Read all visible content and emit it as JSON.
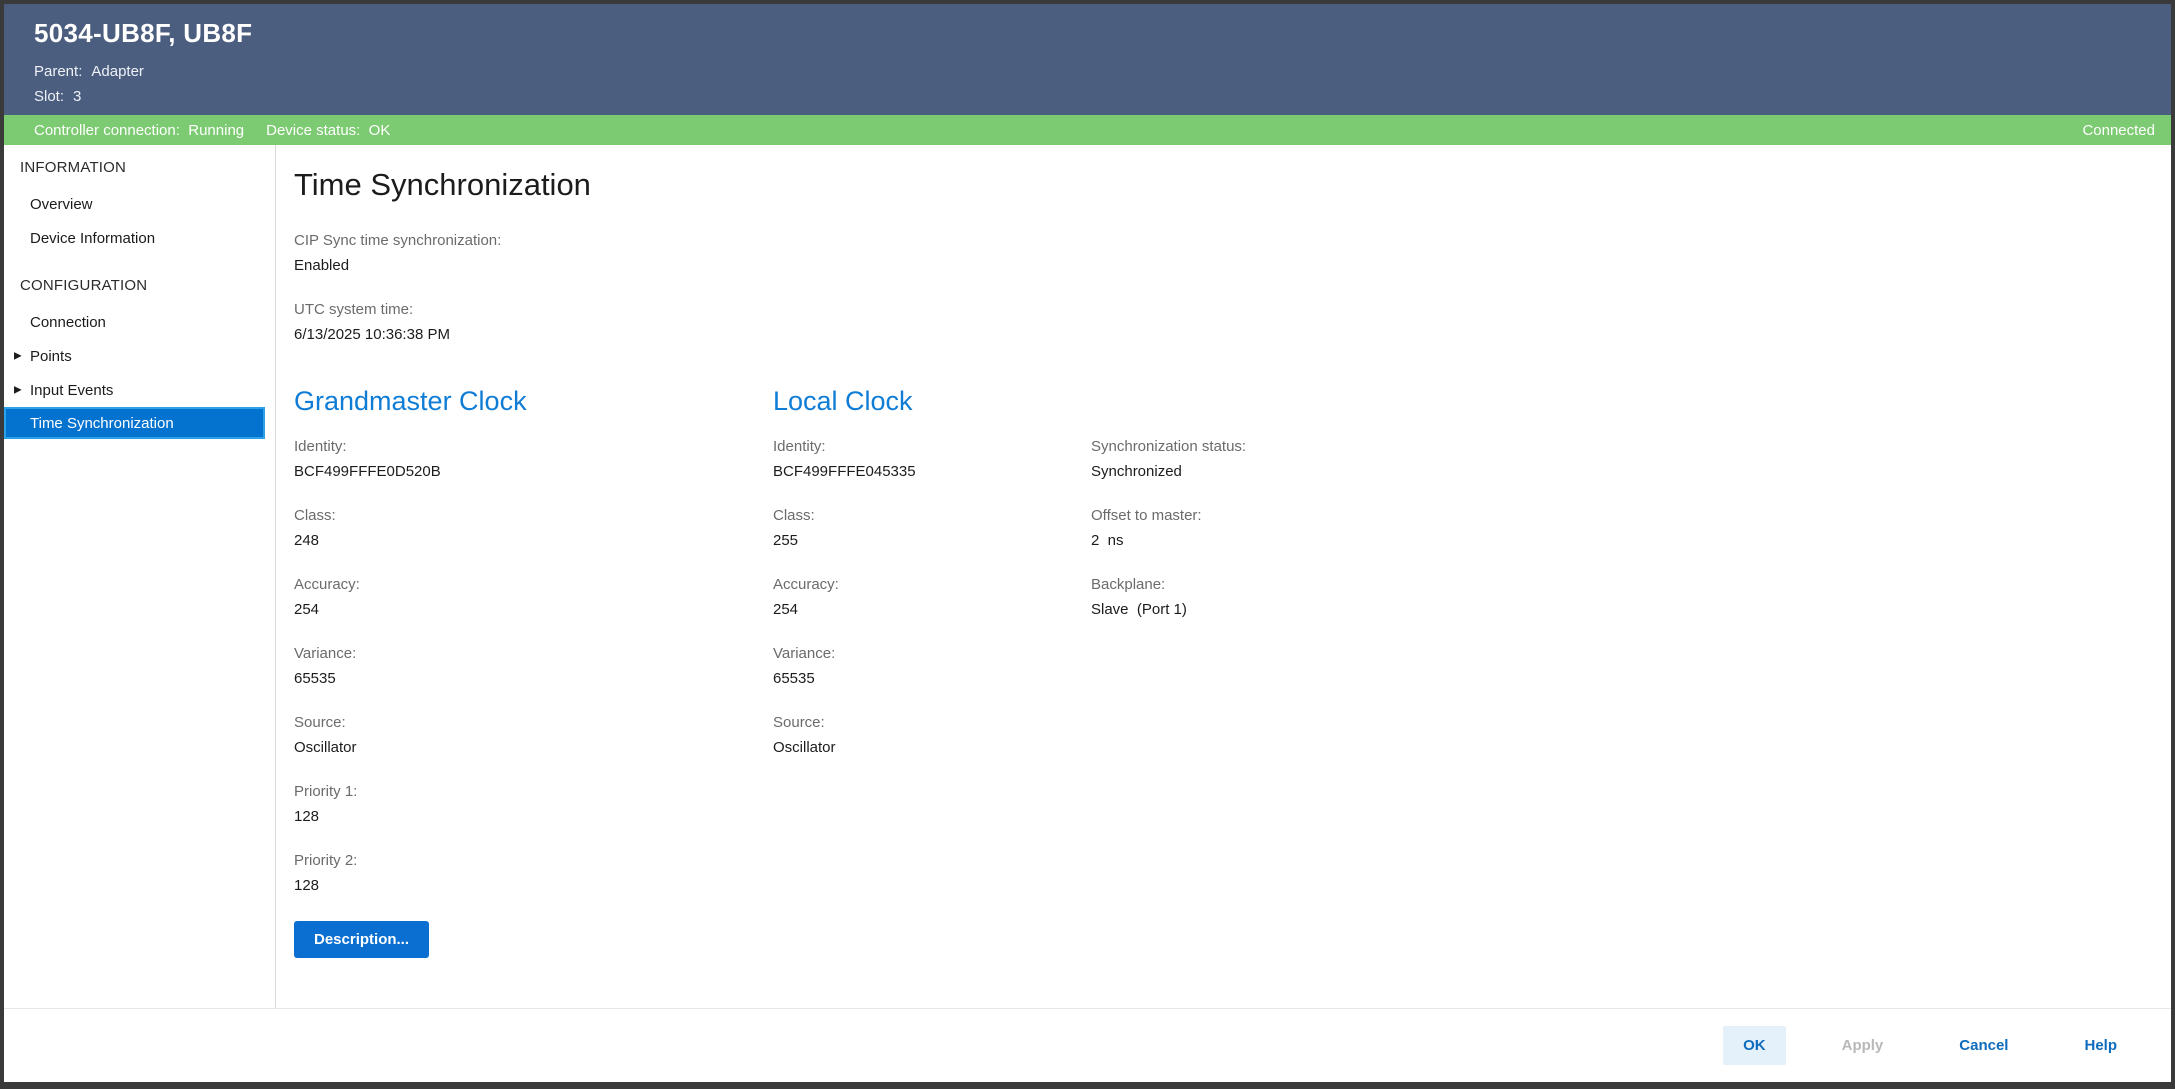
{
  "window": {
    "title": "5034-UB8F, UB8F",
    "parent_label": "Parent:",
    "parent_value": "Adapter",
    "slot_label": "Slot:",
    "slot_value": "3"
  },
  "statusbar": {
    "controller_connection": "Controller connection:  Running",
    "device_status": "Device status:  OK",
    "connection_state": "Connected"
  },
  "sidebar": {
    "groups": [
      {
        "label": "INFORMATION",
        "items": [
          {
            "label": "Overview"
          },
          {
            "label": "Device Information"
          }
        ]
      },
      {
        "label": "CONFIGURATION",
        "items": [
          {
            "label": "Connection"
          },
          {
            "label": "Points",
            "expandable": true
          },
          {
            "label": "Input Events",
            "expandable": true
          },
          {
            "label": "Time Synchronization",
            "selected": true
          }
        ]
      }
    ]
  },
  "icons": {
    "expand_arrow": "▶"
  },
  "main": {
    "title": "Time Synchronization",
    "top_fields": [
      {
        "label": "CIP Sync time synchronization:",
        "value": "Enabled"
      },
      {
        "label": "UTC system time:",
        "value": "6/13/2025 10:36:38 PM"
      }
    ],
    "grandmaster": {
      "heading": "Grandmaster Clock",
      "fields": [
        {
          "label": "Identity:",
          "value": "BCF499FFFE0D520B"
        },
        {
          "label": "Class:",
          "value": "248"
        },
        {
          "label": "Accuracy:",
          "value": "254"
        },
        {
          "label": "Variance:",
          "value": "65535"
        },
        {
          "label": "Source:",
          "value": "Oscillator"
        },
        {
          "label": "Priority 1:",
          "value": "128"
        },
        {
          "label": "Priority 2:",
          "value": "128"
        }
      ],
      "description_button": "Description..."
    },
    "local": {
      "heading": "Local Clock",
      "fields": [
        {
          "label": "Identity:",
          "value": "BCF499FFFE045335"
        },
        {
          "label": "Class:",
          "value": "255"
        },
        {
          "label": "Accuracy:",
          "value": "254"
        },
        {
          "label": "Variance:",
          "value": "65535"
        },
        {
          "label": "Source:",
          "value": "Oscillator"
        }
      ]
    },
    "status_column": {
      "fields": [
        {
          "label": "Synchronization status:",
          "value": "Synchronized"
        },
        {
          "label": "Offset to master:",
          "value": "2  ns"
        },
        {
          "label": "Backplane:",
          "value": "Slave  (Port 1)"
        }
      ]
    }
  },
  "footer": {
    "ok": "OK",
    "apply": "Apply",
    "cancel": "Cancel",
    "help": "Help"
  },
  "colors": {
    "header_bg": "#4c5e7f",
    "status_ok_bg": "#7cca71",
    "selected_item_bg": "#0473cf",
    "selected_item_border": "#2aa2e8",
    "section_heading": "#0f7cd5",
    "primary_button_bg": "#0b6fd1",
    "footer_link": "#0f6cbd",
    "ok_button_bg": "#e4f0fa"
  }
}
